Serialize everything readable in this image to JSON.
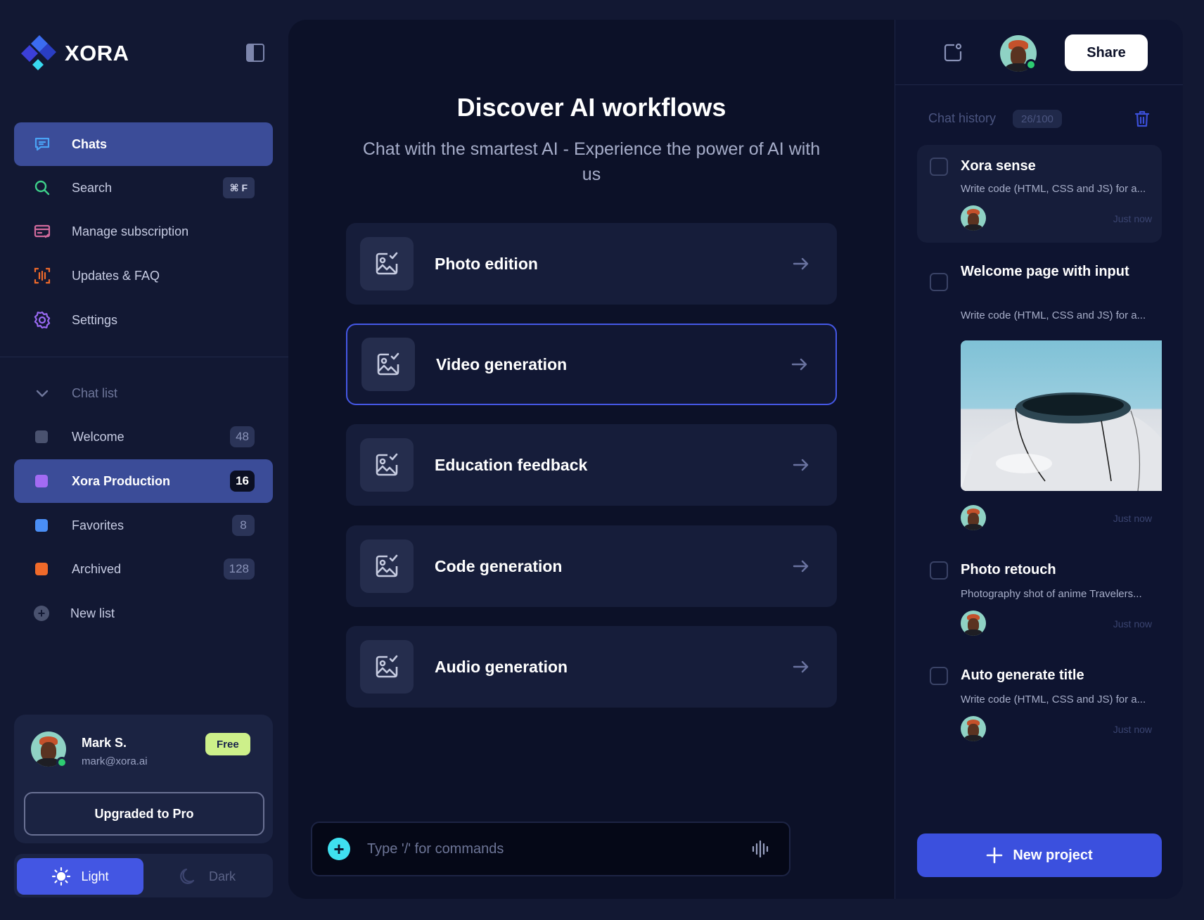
{
  "brand": {
    "name": "XORA"
  },
  "sidebar": {
    "nav": [
      {
        "label": "Chats",
        "icon": "chat-icon"
      },
      {
        "label": "Search",
        "icon": "search-icon",
        "shortcut": "⌘ F"
      },
      {
        "label": "Manage subscription",
        "icon": "card-icon"
      },
      {
        "label": "Updates & FAQ",
        "icon": "broadcast-icon"
      },
      {
        "label": "Settings",
        "icon": "gear-icon"
      }
    ],
    "chat_list": {
      "header": "Chat list",
      "items": [
        {
          "label": "Welcome",
          "count": "48",
          "color": "#4a526f"
        },
        {
          "label": "Xora Production",
          "count": "16",
          "color": "#a26bf3"
        },
        {
          "label": "Favorites",
          "count": "8",
          "color": "#4a8ef5"
        },
        {
          "label": "Archived",
          "count": "128",
          "color": "#f06a2a"
        }
      ],
      "new_list": "New list"
    },
    "user": {
      "name": "Mark S.",
      "email": "mark@xora.ai",
      "plan": "Free",
      "upgrade_label": "Upgraded to Pro"
    },
    "theme": {
      "light": "Light",
      "dark": "Dark"
    }
  },
  "main": {
    "title": "Discover AI workflows",
    "subtitle": "Chat with the smartest AI - Experience the power of AI with us",
    "workflows": [
      {
        "label": "Photo edition",
        "icon": "image-icon"
      },
      {
        "label": "Video generation",
        "icon": "image-icon"
      },
      {
        "label": "Education feedback",
        "icon": "image-icon"
      },
      {
        "label": "Code generation",
        "icon": "image-icon"
      },
      {
        "label": "Audio generation",
        "icon": "image-icon"
      }
    ],
    "composer": {
      "placeholder": "Type '/' for commands"
    }
  },
  "right": {
    "share_label": "Share",
    "history_label": "Chat history",
    "history_count": "26/100",
    "history": [
      {
        "title": "Xora sense",
        "desc": "Write code (HTML, CSS and JS) for a...",
        "time": "Just now"
      },
      {
        "title": "Welcome page with input",
        "desc": "Write code (HTML, CSS and JS) for a...",
        "time": "Just now"
      },
      {
        "title": "Photo retouch",
        "desc": "Photography shot of anime Travelers...",
        "time": "Just now"
      },
      {
        "title": "Auto generate title",
        "desc": "Write code (HTML, CSS and JS) for a...",
        "time": "Just now"
      }
    ],
    "new_project_label": "New project"
  },
  "colors": {
    "accent": "#4356e3",
    "active_nav": "#3b4c98",
    "online": "#2ecc71",
    "free_badge": "#cdf08a"
  }
}
